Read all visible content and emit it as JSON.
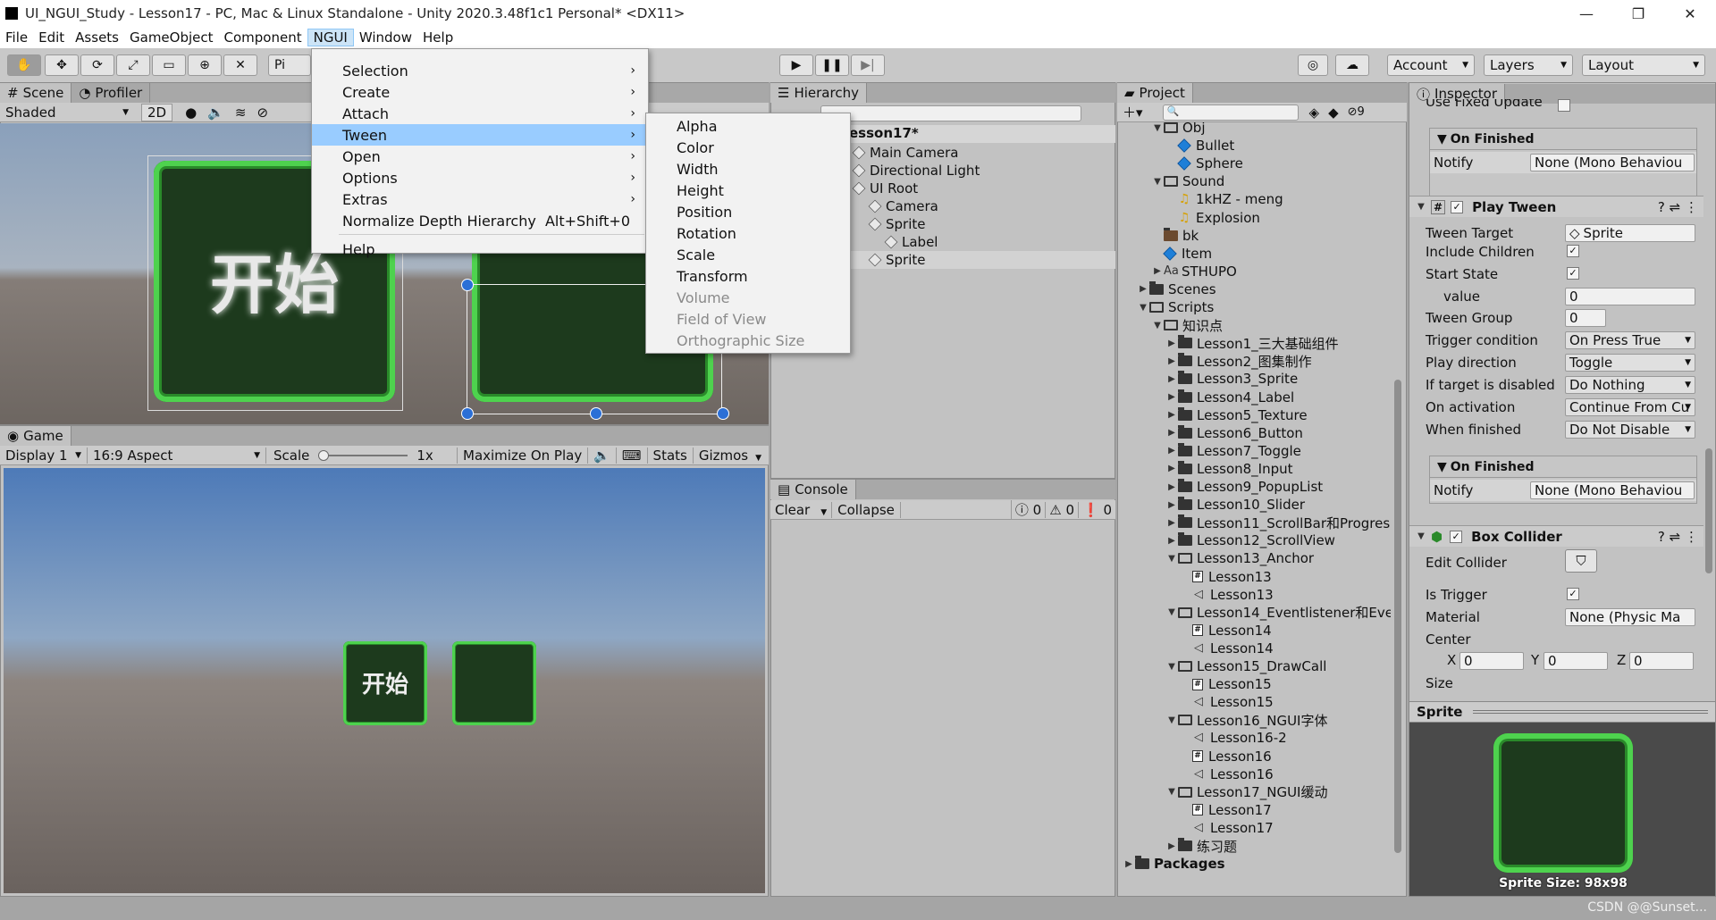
{
  "window": {
    "title": "UI_NGUI_Study - Lesson17 - PC, Mac & Linux Standalone - Unity 2020.3.48f1c1 Personal* <DX11>",
    "minimize": "—",
    "maximize": "❐",
    "close": "✕"
  },
  "menubar": [
    "File",
    "Edit",
    "Assets",
    "GameObject",
    "Component",
    "NGUI",
    "Window",
    "Help"
  ],
  "toolbar": {
    "pivot": "Pi",
    "account": "Account",
    "layers": "Layers",
    "layout": "Layout"
  },
  "ngui_menu": {
    "items": [
      {
        "label": "Selection",
        "submenu": true
      },
      {
        "label": "Create",
        "submenu": true
      },
      {
        "label": "Attach",
        "submenu": true
      },
      {
        "label": "Tween",
        "submenu": true,
        "highlighted": true
      },
      {
        "label": "Open",
        "submenu": true
      },
      {
        "label": "Options",
        "submenu": true
      },
      {
        "label": "Extras",
        "submenu": true
      },
      {
        "label": "Normalize Depth Hierarchy",
        "shortcut": "Alt+Shift+0"
      },
      {
        "label": "Help"
      }
    ]
  },
  "tween_menu": {
    "items": [
      {
        "label": "Alpha"
      },
      {
        "label": "Color"
      },
      {
        "label": "Width"
      },
      {
        "label": "Height"
      },
      {
        "label": "Position"
      },
      {
        "label": "Rotation"
      },
      {
        "label": "Scale"
      },
      {
        "label": "Transform"
      },
      {
        "label": "Volume",
        "disabled": true
      },
      {
        "label": "Field of View",
        "disabled": true
      },
      {
        "label": "Orthographic Size",
        "disabled": true
      }
    ]
  },
  "scene": {
    "tabs": [
      "Scene",
      "Profiler"
    ],
    "shading": "Shaded",
    "mode_2d": "2D",
    "button_text": "开始"
  },
  "game": {
    "tab": "Game",
    "display": "Display 1",
    "aspect": "16:9 Aspect",
    "scale_label": "Scale",
    "scale_value": "1x",
    "maximize": "Maximize On Play",
    "stats": "Stats",
    "gizmos": "Gizmos",
    "button_text": "开始"
  },
  "hierarchy": {
    "tab": "Hierarchy",
    "scene_name": "esson17*",
    "items": [
      {
        "label": "Main Camera",
        "depth": 0
      },
      {
        "label": "Directional Light",
        "depth": 0
      },
      {
        "label": "UI Root",
        "depth": 0
      },
      {
        "label": "Camera",
        "depth": 1
      },
      {
        "label": "Sprite",
        "depth": 1
      },
      {
        "label": "Label",
        "depth": 2
      },
      {
        "label": "Sprite",
        "depth": 1,
        "selected": true
      }
    ]
  },
  "console": {
    "tab": "Console",
    "clear": "Clear",
    "collapse": "Collapse",
    "logs": "0",
    "warnings": "0",
    "errors": "0"
  },
  "project": {
    "tab": "Project",
    "badge": "9",
    "items": [
      {
        "label": "Obj",
        "depth": 2,
        "type": "openfolder",
        "arrow": "down"
      },
      {
        "label": "Bullet",
        "depth": 3,
        "type": "prefab"
      },
      {
        "label": "Sphere",
        "depth": 3,
        "type": "prefab"
      },
      {
        "label": "Sound",
        "depth": 2,
        "type": "openfolder",
        "arrow": "down"
      },
      {
        "label": "1kHZ - meng",
        "depth": 3,
        "type": "audio"
      },
      {
        "label": "Explosion",
        "depth": 3,
        "type": "audio"
      },
      {
        "label": "bk",
        "depth": 2,
        "type": "image"
      },
      {
        "label": "Item",
        "depth": 2,
        "type": "prefab"
      },
      {
        "label": "STHUPO",
        "depth": 2,
        "type": "font",
        "arrow": "right"
      },
      {
        "label": "Scenes",
        "depth": 1,
        "type": "folder",
        "arrow": "right"
      },
      {
        "label": "Scripts",
        "depth": 1,
        "type": "openfolder",
        "arrow": "down"
      },
      {
        "label": "知识点",
        "depth": 2,
        "type": "openfolder",
        "arrow": "down"
      },
      {
        "label": "Lesson1_三大基础组件",
        "depth": 3,
        "type": "folder",
        "arrow": "right"
      },
      {
        "label": "Lesson2_图集制作",
        "depth": 3,
        "type": "folder",
        "arrow": "right"
      },
      {
        "label": "Lesson3_Sprite",
        "depth": 3,
        "type": "folder",
        "arrow": "right"
      },
      {
        "label": "Lesson4_Label",
        "depth": 3,
        "type": "folder",
        "arrow": "right"
      },
      {
        "label": "Lesson5_Texture",
        "depth": 3,
        "type": "folder",
        "arrow": "right"
      },
      {
        "label": "Lesson6_Button",
        "depth": 3,
        "type": "folder",
        "arrow": "right"
      },
      {
        "label": "Lesson7_Toggle",
        "depth": 3,
        "type": "folder",
        "arrow": "right"
      },
      {
        "label": "Lesson8_Input",
        "depth": 3,
        "type": "folder",
        "arrow": "right"
      },
      {
        "label": "Lesson9_PopupList",
        "depth": 3,
        "type": "folder",
        "arrow": "right"
      },
      {
        "label": "Lesson10_Slider",
        "depth": 3,
        "type": "folder",
        "arrow": "right"
      },
      {
        "label": "Lesson11_ScrollBar和Progress",
        "depth": 3,
        "type": "folder",
        "arrow": "right"
      },
      {
        "label": "Lesson12_ScrollView",
        "depth": 3,
        "type": "folder",
        "arrow": "right"
      },
      {
        "label": "Lesson13_Anchor",
        "depth": 3,
        "type": "openfolder",
        "arrow": "down"
      },
      {
        "label": "Lesson13",
        "depth": 4,
        "type": "script"
      },
      {
        "label": "Lesson13",
        "depth": 4,
        "type": "scene"
      },
      {
        "label": "Lesson14_Eventlistener和Eve",
        "depth": 3,
        "type": "openfolder",
        "arrow": "down"
      },
      {
        "label": "Lesson14",
        "depth": 4,
        "type": "script"
      },
      {
        "label": "Lesson14",
        "depth": 4,
        "type": "scene"
      },
      {
        "label": "Lesson15_DrawCall",
        "depth": 3,
        "type": "openfolder",
        "arrow": "down"
      },
      {
        "label": "Lesson15",
        "depth": 4,
        "type": "script"
      },
      {
        "label": "Lesson15",
        "depth": 4,
        "type": "scene"
      },
      {
        "label": "Lesson16_NGUI字体",
        "depth": 3,
        "type": "openfolder",
        "arrow": "down"
      },
      {
        "label": "Lesson16-2",
        "depth": 4,
        "type": "scene"
      },
      {
        "label": "Lesson16",
        "depth": 4,
        "type": "script"
      },
      {
        "label": "Lesson16",
        "depth": 4,
        "type": "scene"
      },
      {
        "label": "Lesson17_NGUI缓动",
        "depth": 3,
        "type": "openfolder",
        "arrow": "down"
      },
      {
        "label": "Lesson17",
        "depth": 4,
        "type": "script"
      },
      {
        "label": "Lesson17",
        "depth": 4,
        "type": "scene"
      },
      {
        "label": "练习题",
        "depth": 3,
        "type": "folder",
        "arrow": "right"
      },
      {
        "label": "Packages",
        "depth": 0,
        "type": "folder",
        "arrow": "right",
        "bold": true
      }
    ]
  },
  "inspector": {
    "tab": "Inspector",
    "top_cut_label": "Use Fixed Update",
    "on_finished_1": "On Finished",
    "notify_label": "Notify",
    "notify_value": "None (Mono Behaviou",
    "play_tween": {
      "title": "Play Tween",
      "tween_target_label": "Tween Target",
      "tween_target_value": "Sprite",
      "include_children_label": "Include Children",
      "start_state_label": "Start State",
      "value_label": "value",
      "value_value": "0",
      "tween_group_label": "Tween Group",
      "tween_group_value": "0",
      "trigger_label": "Trigger condition",
      "trigger_value": "On Press True",
      "play_dir_label": "Play direction",
      "play_dir_value": "Toggle",
      "if_disabled_label": "If target is disabled",
      "if_disabled_value": "Do Nothing",
      "on_activation_label": "On activation",
      "on_activation_value": "Continue From Cu",
      "when_finished_label": "When finished",
      "when_finished_value": "Do Not Disable",
      "on_finished": "On Finished",
      "notify_label": "Notify",
      "notify_value": "None (Mono Behaviou"
    },
    "box_collider": {
      "title": "Box Collider",
      "edit_label": "Edit Collider",
      "is_trigger_label": "Is Trigger",
      "material_label": "Material",
      "material_value": "None (Physic Ma",
      "center_label": "Center",
      "x_label": "X",
      "x_value": "0",
      "y_label": "Y",
      "y_value": "0",
      "z_label": "Z",
      "z_value": "0",
      "size_label": "Size"
    },
    "preview_title": "Sprite",
    "sprite_size": "Sprite Size: 98x98"
  },
  "watermark": "CSDN @@Sunset..."
}
